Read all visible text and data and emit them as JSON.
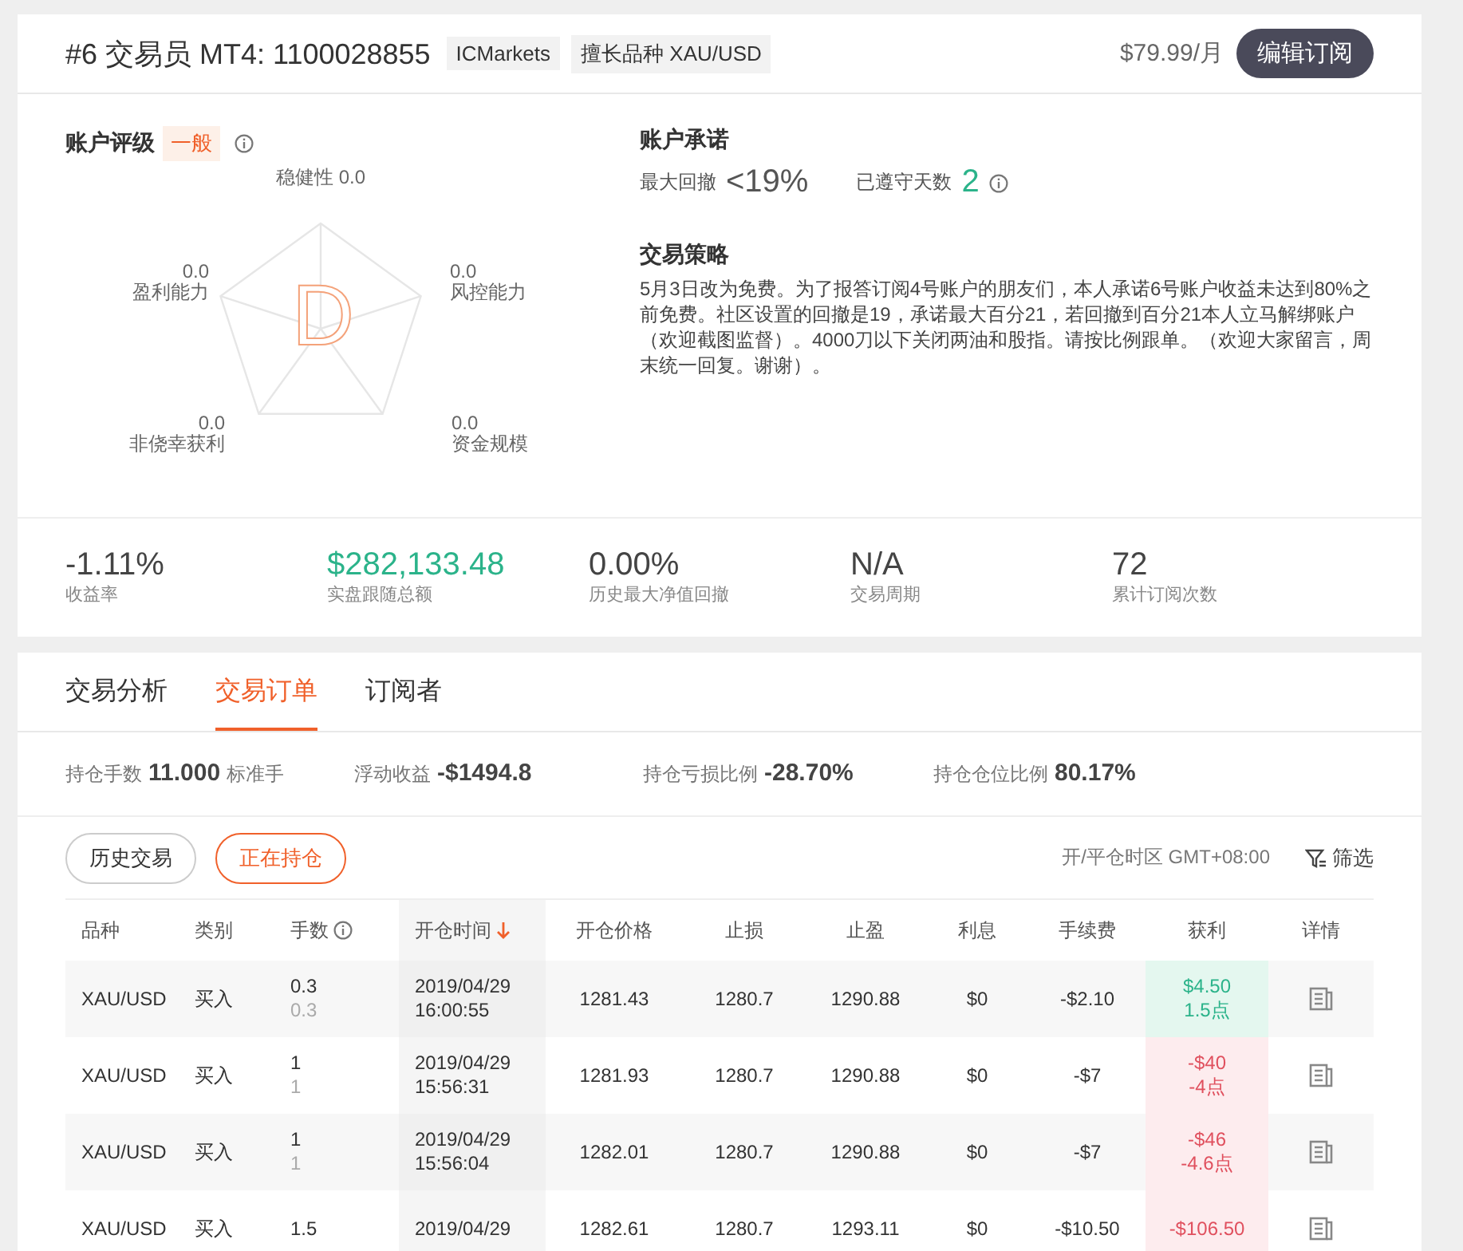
{
  "header": {
    "rank": "#6",
    "role": "交易员",
    "account": "MT4: 1100028855",
    "tags": [
      "ICMarkets",
      "擅长品种 XAU/USD"
    ],
    "price": "$79.99/月",
    "action": "编辑订阅"
  },
  "rating": {
    "title": "账户评级",
    "level": "一般",
    "grade": "D",
    "axes": [
      {
        "label": "稳健性",
        "value": "0.0"
      },
      {
        "label": "盈利能力",
        "value": "0.0"
      },
      {
        "label": "风控能力",
        "value": "0.0"
      },
      {
        "label": "非侥幸获利",
        "value": "0.0"
      },
      {
        "label": "资金规模",
        "value": "0.0"
      }
    ]
  },
  "commitment": {
    "title": "账户承诺",
    "drawdown_label": "最大回撤",
    "drawdown": "<19%",
    "days_label": "已遵守天数",
    "days": "2"
  },
  "strategy": {
    "title": "交易策略",
    "text": "5月3日改为免费。为了报答订阅4号账户的朋友们，本人承诺6号账户收益未达到80%之前免费。社区设置的回撤是19，承诺最大百分21，若回撤到百分21本人立马解绑账户（欢迎截图监督）。4000刀以下关闭两油和股指。请按比例跟单。（欢迎大家留言，周末统一回复。谢谢）。"
  },
  "stats": [
    {
      "value": "-1.11%",
      "label": "收益率",
      "kind": "plain"
    },
    {
      "value": "$282,133.48",
      "label": "实盘跟随总额",
      "kind": "positive"
    },
    {
      "value": "0.00%",
      "label": "历史最大净值回撤",
      "kind": "plain"
    },
    {
      "value": "N/A",
      "label": "交易周期",
      "kind": "plain"
    },
    {
      "value": "72",
      "label": "累计订阅次数",
      "kind": "plain"
    }
  ],
  "tabs": [
    {
      "label": "交易分析",
      "selected": false
    },
    {
      "label": "交易订单",
      "selected": true
    },
    {
      "label": "订阅者",
      "selected": false
    }
  ],
  "summary": [
    {
      "label": "持仓手数",
      "value": "11.000",
      "unit": "标准手"
    },
    {
      "label": "浮动收益",
      "value": "-$1494.8"
    },
    {
      "label": "持仓亏损比例",
      "value": "-28.70%"
    },
    {
      "label": "持仓仓位比例",
      "value": "80.17%"
    }
  ],
  "filters": [
    {
      "label": "历史交易",
      "selected": false
    },
    {
      "label": "正在持仓",
      "selected": true
    }
  ],
  "timezone": "开/平仓时区 GMT+08:00",
  "filter_button": "筛选",
  "table": {
    "columns": [
      {
        "label": "品种",
        "sorted": false
      },
      {
        "label": "类别",
        "sorted": false
      },
      {
        "label": "手数",
        "sorted": false,
        "info": true
      },
      {
        "label": "开仓时间",
        "sorted": true
      },
      {
        "label": "开仓价格",
        "sorted": false
      },
      {
        "label": "止损",
        "sorted": false
      },
      {
        "label": "止盈",
        "sorted": false
      },
      {
        "label": "利息",
        "sorted": false
      },
      {
        "label": "手续费",
        "sorted": false
      },
      {
        "label": "获利",
        "sorted": false
      },
      {
        "label": "详情",
        "sorted": false
      }
    ],
    "rows": [
      {
        "symbol": "XAU/USD",
        "side": "买入",
        "lots": "0.3",
        "lots_open": "0.3",
        "date": "2019/04/29",
        "time": "16:00:55",
        "open": "1281.43",
        "sl": "1280.7",
        "tp": "1290.88",
        "swap": "$0",
        "fee": "-$2.10",
        "profit": "$4.50",
        "points": "1.5点",
        "kind": "gain"
      },
      {
        "symbol": "XAU/USD",
        "side": "买入",
        "lots": "1",
        "lots_open": "1",
        "date": "2019/04/29",
        "time": "15:56:31",
        "open": "1281.93",
        "sl": "1280.7",
        "tp": "1290.88",
        "swap": "$0",
        "fee": "-$7",
        "profit": "-$40",
        "points": "-4点",
        "kind": "loss"
      },
      {
        "symbol": "XAU/USD",
        "side": "买入",
        "lots": "1",
        "lots_open": "1",
        "date": "2019/04/29",
        "time": "15:56:04",
        "open": "1282.01",
        "sl": "1280.7",
        "tp": "1290.88",
        "swap": "$0",
        "fee": "-$7",
        "profit": "-$46",
        "points": "-4.6点",
        "kind": "loss"
      },
      {
        "symbol": "XAU/USD",
        "side": "买入",
        "lots": "1.5",
        "date": "2019/04/29",
        "open": "1282.61",
        "sl": "1280.7",
        "tp": "1293.11",
        "swap": "$0",
        "fee": "-$10.50",
        "profit": "-$106.50",
        "kind": "loss"
      }
    ]
  }
}
